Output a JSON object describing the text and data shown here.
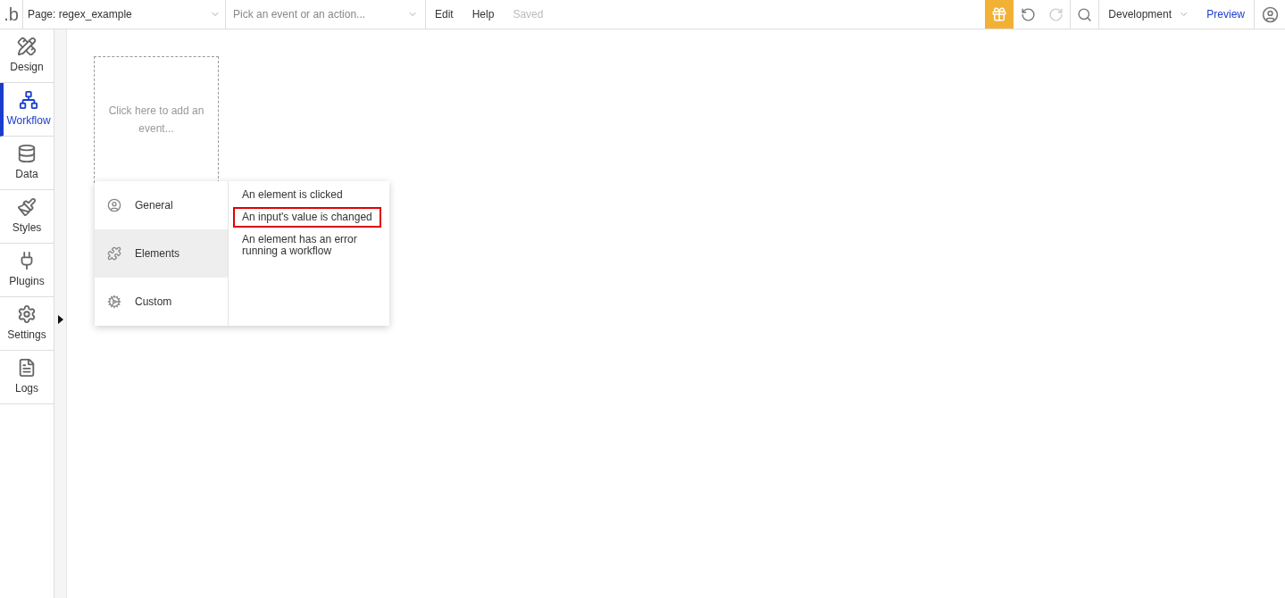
{
  "topbar": {
    "logo": ".b",
    "page_selector": "Page: regex_example",
    "event_picker": {
      "placeholder": "Pick an event or an action..."
    },
    "menu": [
      "Edit",
      "Help"
    ],
    "save_status": "Saved",
    "redo_disabled": true,
    "environment": "Development",
    "preview": "Preview"
  },
  "sidebar": {
    "items": [
      {
        "kind": "design",
        "label": "Design",
        "selected": false
      },
      {
        "kind": "workflow",
        "label": "Workflow",
        "selected": true
      },
      {
        "kind": "data",
        "label": "Data",
        "selected": false
      },
      {
        "kind": "styles",
        "label": "Styles",
        "selected": false
      },
      {
        "kind": "plugins",
        "label": "Plugins",
        "selected": false
      },
      {
        "kind": "settings",
        "label": "Settings",
        "selected": false
      },
      {
        "kind": "logs",
        "label": "Logs",
        "selected": false
      }
    ]
  },
  "canvas": {
    "event_placeholder": "Click here to add an event...",
    "event_menu": {
      "categories": [
        {
          "kind": "general",
          "label": "General",
          "selected": false
        },
        {
          "kind": "elements",
          "label": "Elements",
          "selected": true
        },
        {
          "kind": "custom",
          "label": "Custom",
          "selected": false
        }
      ],
      "events": [
        {
          "label": "An element is clicked",
          "highlighted": false
        },
        {
          "label": "An input's value is changed",
          "highlighted": true
        },
        {
          "label": "An element has an error running a workflow",
          "highlighted": false
        }
      ]
    }
  }
}
